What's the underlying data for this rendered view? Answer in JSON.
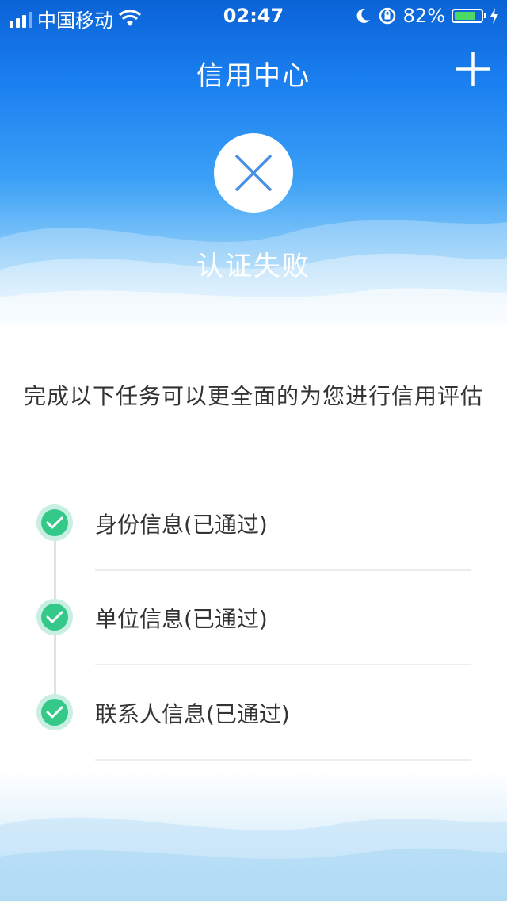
{
  "status_bar": {
    "carrier": "中国移动",
    "time": "02:47",
    "battery_percent": "82%",
    "battery_level": 0.82,
    "icons": [
      "signal-icon",
      "wifi-icon",
      "moon-icon",
      "rotation-lock-icon",
      "battery-icon",
      "charging-icon"
    ]
  },
  "nav": {
    "title": "信用中心",
    "add_icon": "plus-icon"
  },
  "result": {
    "status_icon": "close-icon",
    "status_text": "认证失败"
  },
  "subtitle": "完成以下任务可以更全面的为您进行信用评估",
  "steps": [
    {
      "label": "身份信息(已通过)",
      "icon": "check-icon",
      "status": "passed"
    },
    {
      "label": "单位信息(已通过)",
      "icon": "check-icon",
      "status": "passed"
    },
    {
      "label": "联系人信息(已通过)",
      "icon": "check-icon",
      "status": "passed"
    }
  ],
  "colors": {
    "header_blue": "#0a63d6",
    "check_green": "#34c889",
    "fail_icon_blue": "#4a8fe6",
    "battery_green": "#4cd964"
  }
}
